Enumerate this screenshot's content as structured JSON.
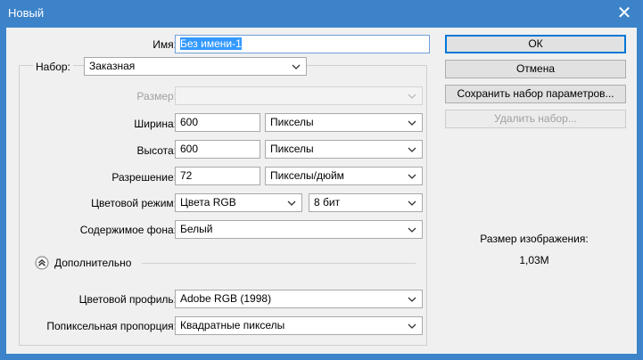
{
  "window": {
    "title": "Новый"
  },
  "form": {
    "name": {
      "label": "Имя:",
      "value": "Без имени-1"
    },
    "preset": {
      "label": "Набор:",
      "value": "Заказная"
    },
    "size": {
      "label": "Размер:",
      "value": ""
    },
    "width": {
      "label": "Ширина:",
      "value": "600",
      "unit": "Пикселы"
    },
    "height": {
      "label": "Высота:",
      "value": "600",
      "unit": "Пикселы"
    },
    "resolution": {
      "label": "Разрешение:",
      "value": "72",
      "unit": "Пикселы/дюйм"
    },
    "color_mode": {
      "label": "Цветовой режим:",
      "value": "Цвета RGB",
      "depth": "8 бит"
    },
    "background": {
      "label": "Содержимое фона:",
      "value": "Белый"
    },
    "advanced": {
      "label": "Дополнительно"
    },
    "color_profile": {
      "label": "Цветовой профиль:",
      "value": "Adobe RGB (1998)"
    },
    "pixel_aspect": {
      "label": "Попиксельная пропорция:",
      "value": "Квадратные пикселы"
    }
  },
  "buttons": {
    "ok": "ОК",
    "cancel": "Отмена",
    "save_preset": "Сохранить набор параметров...",
    "delete_preset": "Удалить набор..."
  },
  "image_size": {
    "label": "Размер изображения:",
    "value": "1,03M"
  },
  "icons": {
    "close": "close-icon",
    "dropdown": "chevron-down-icon",
    "collapse": "double-chevron-up-icon"
  }
}
